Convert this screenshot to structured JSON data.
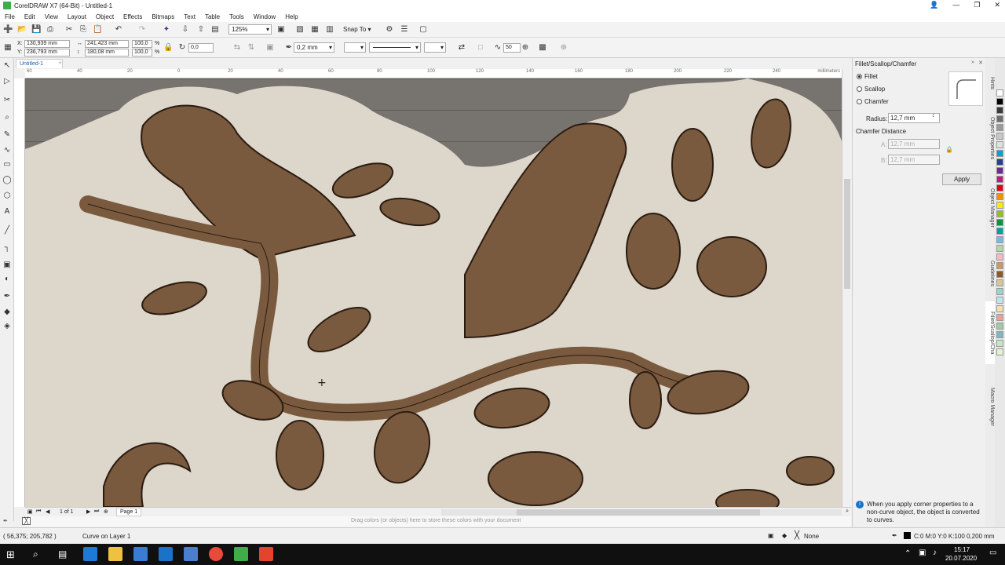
{
  "app": {
    "title": "CorelDRAW X7 (64-Bit) - Untitled-1"
  },
  "menu": [
    "File",
    "Edit",
    "View",
    "Layout",
    "Object",
    "Effects",
    "Bitmaps",
    "Text",
    "Table",
    "Tools",
    "Window",
    "Help"
  ],
  "toolbar1": {
    "zoom": "125%",
    "snap_to": "Snap To"
  },
  "propbar": {
    "x_label": "X:",
    "x": "130,939 mm",
    "y_label": "Y:",
    "y": "236,793 mm",
    "w": "241,423 mm",
    "h": "180,08 mm",
    "sx": "100,0",
    "sy": "100,0",
    "pct": "%",
    "angle": "0,0",
    "outline": "0,2 mm",
    "smooth": "50"
  },
  "doc_tab": "Untitled-1",
  "ruler": {
    "ticks": [
      "60",
      "40",
      "20",
      "0",
      "20",
      "40",
      "60",
      "80",
      "100",
      "120",
      "140",
      "160",
      "180",
      "200",
      "220",
      "240"
    ],
    "units": "millimeters"
  },
  "pagenav": {
    "counter": "1 of 1",
    "page": "Page 1"
  },
  "colorbar_hint": "Drag colors (or objects) here to store these colors with your document",
  "status": {
    "coords": "( 56,375; 205,782 )",
    "object": "Curve on Layer 1",
    "fill_none": "None",
    "outline_info": "C:0 M:0 Y:0 K:100  0,200 mm"
  },
  "docker": {
    "title": "Fillet/Scallop/Chamfer",
    "options": [
      "Fillet",
      "Scallop",
      "Chamfer"
    ],
    "selected": "Fillet",
    "radius_label": "Radius:",
    "radius": "12,7 mm",
    "chamfer_label": "Chamfer Distance",
    "a_label": "A:",
    "a": "12,7 mm",
    "b_label": "B:",
    "b": "12,7 mm",
    "apply": "Apply",
    "note": "When you apply corner properties to a non-curve object, the object is converted to curves."
  },
  "docker_tabs": [
    "Hints",
    "Object Properties",
    "Object Manager",
    "Guidelines",
    "Fillet/Scallop/Cha",
    "Macro Manager"
  ],
  "palette": [
    "#ffffff",
    "#000000",
    "#3a3a3a",
    "#6d6d6d",
    "#9a9a9a",
    "#c8c8c8",
    "#e0e0e0",
    "#00a0e3",
    "#2a3e94",
    "#6a2c8e",
    "#c1197a",
    "#e3001b",
    "#f39200",
    "#ffed00",
    "#95c11f",
    "#009640",
    "#00a19a",
    "#7ab8e0",
    "#b5d7a8",
    "#f7b9c4",
    "#c79a6b",
    "#8a5a2b",
    "#d9c3a0",
    "#a0cfd0",
    "#bfe3ef",
    "#f6e0a5",
    "#e8a0a0",
    "#a3c9a0",
    "#7fb7c2",
    "#c7e6c7",
    "#e4f2ce"
  ],
  "clock": {
    "time": "15:17",
    "date": "20.07.2020"
  }
}
